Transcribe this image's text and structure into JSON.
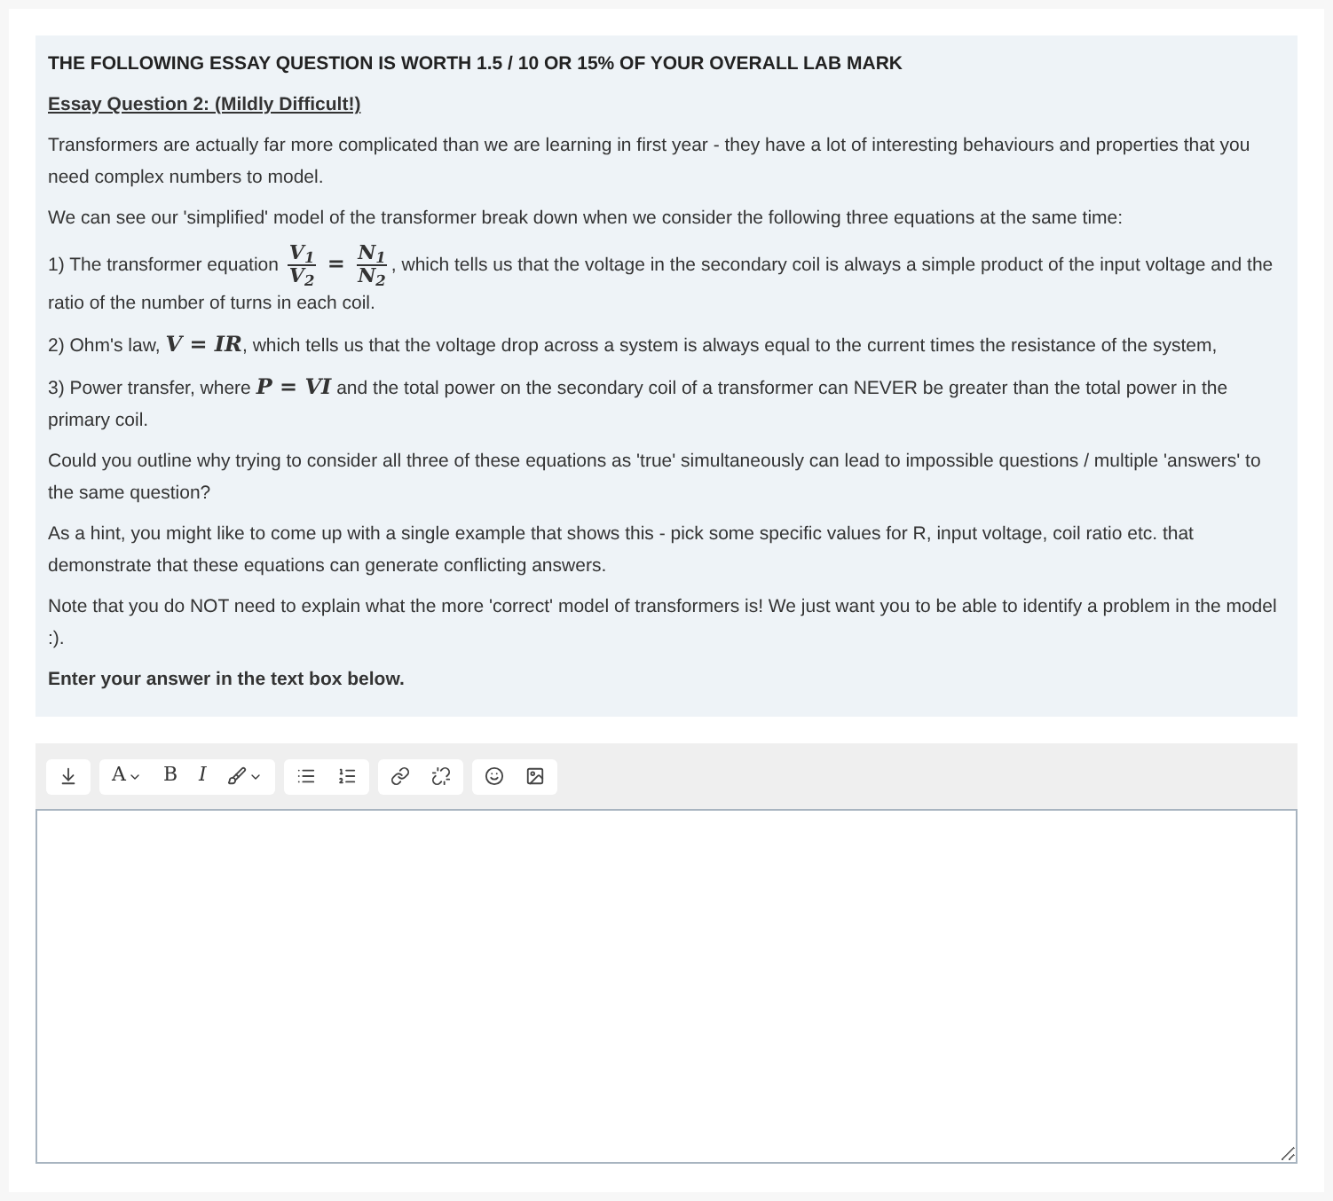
{
  "question": {
    "heading": "THE FOLLOWING ESSAY QUESTION IS WORTH 1.5 / 10 OR 15% OF YOUR OVERALL LAB MARK",
    "title": "Essay Question 2: (Mildly Difficult!)",
    "paragraphs": [
      {
        "kind": "text",
        "segments": [
          {
            "kind": "text",
            "text": "Transformers are actually far more complicated than we are learning in first year - they have a lot of interesting behaviours and properties that you need complex numbers to model."
          }
        ]
      },
      {
        "kind": "text",
        "segments": [
          {
            "kind": "text",
            "text": "We can see our 'simplified' model of the transformer break down when we consider the following three equations at the same time:"
          }
        ]
      },
      {
        "kind": "text",
        "segments": [
          {
            "kind": "text",
            "text": "1) The transformer equation "
          },
          {
            "kind": "fraction",
            "numerator": "V$_{1}$",
            "denominator": "V$_{2}$"
          },
          {
            "kind": "math",
            "text": " = "
          },
          {
            "kind": "fraction",
            "numerator": "N$_{1}$",
            "denominator": "N$_{2}$"
          },
          {
            "kind": "text",
            "text": ", which tells us that the voltage in the secondary coil is always a simple product of the input voltage and the ratio of the number of turns in each coil."
          }
        ]
      },
      {
        "kind": "text",
        "segments": [
          {
            "kind": "text",
            "text": "2) Ohm's law, "
          },
          {
            "kind": "math",
            "text": "V = IR"
          },
          {
            "kind": "text",
            "text": ", which tells us that the voltage drop across a system is always equal to the current times the resistance of the system,"
          }
        ]
      },
      {
        "kind": "text",
        "segments": [
          {
            "kind": "text",
            "text": "3) Power transfer, where "
          },
          {
            "kind": "math",
            "text": "P = VI"
          },
          {
            "kind": "text",
            "text": " and the total power on the secondary coil of a transformer can NEVER be greater than the total power in the primary coil."
          }
        ]
      },
      {
        "kind": "text",
        "segments": [
          {
            "kind": "text",
            "text": "Could you outline why trying to consider all three of these equations as 'true' simultaneously can lead to impossible questions / multiple 'answers' to the same question?"
          }
        ]
      },
      {
        "kind": "text",
        "segments": [
          {
            "kind": "text",
            "text": "As a hint, you might like to come up with a single example that shows this - pick some specific values for R, input voltage, coil ratio etc. that demonstrate that these equations can generate conflicting answers."
          }
        ]
      },
      {
        "kind": "text",
        "segments": [
          {
            "kind": "text",
            "text": "Note that you do NOT need to explain what the more 'correct' model of transformers is! We just want you to be able to identify a problem in the model :)."
          }
        ]
      },
      {
        "kind": "instruction",
        "segments": [
          {
            "kind": "text",
            "text": "Enter your answer in the text box below."
          }
        ]
      }
    ]
  },
  "toolbar": {
    "groups": [
      [
        {
          "kind": "toggle"
        }
      ],
      [
        {
          "kind": "font-color",
          "label": "A"
        },
        {
          "kind": "bold",
          "label": "B"
        },
        {
          "kind": "italic",
          "label": "I"
        },
        {
          "kind": "style"
        }
      ],
      [
        {
          "kind": "bullets"
        },
        {
          "kind": "numbers"
        }
      ],
      [
        {
          "kind": "link"
        },
        {
          "kind": "unlink"
        }
      ],
      [
        {
          "kind": "emoji"
        },
        {
          "kind": "image"
        }
      ]
    ]
  }
}
